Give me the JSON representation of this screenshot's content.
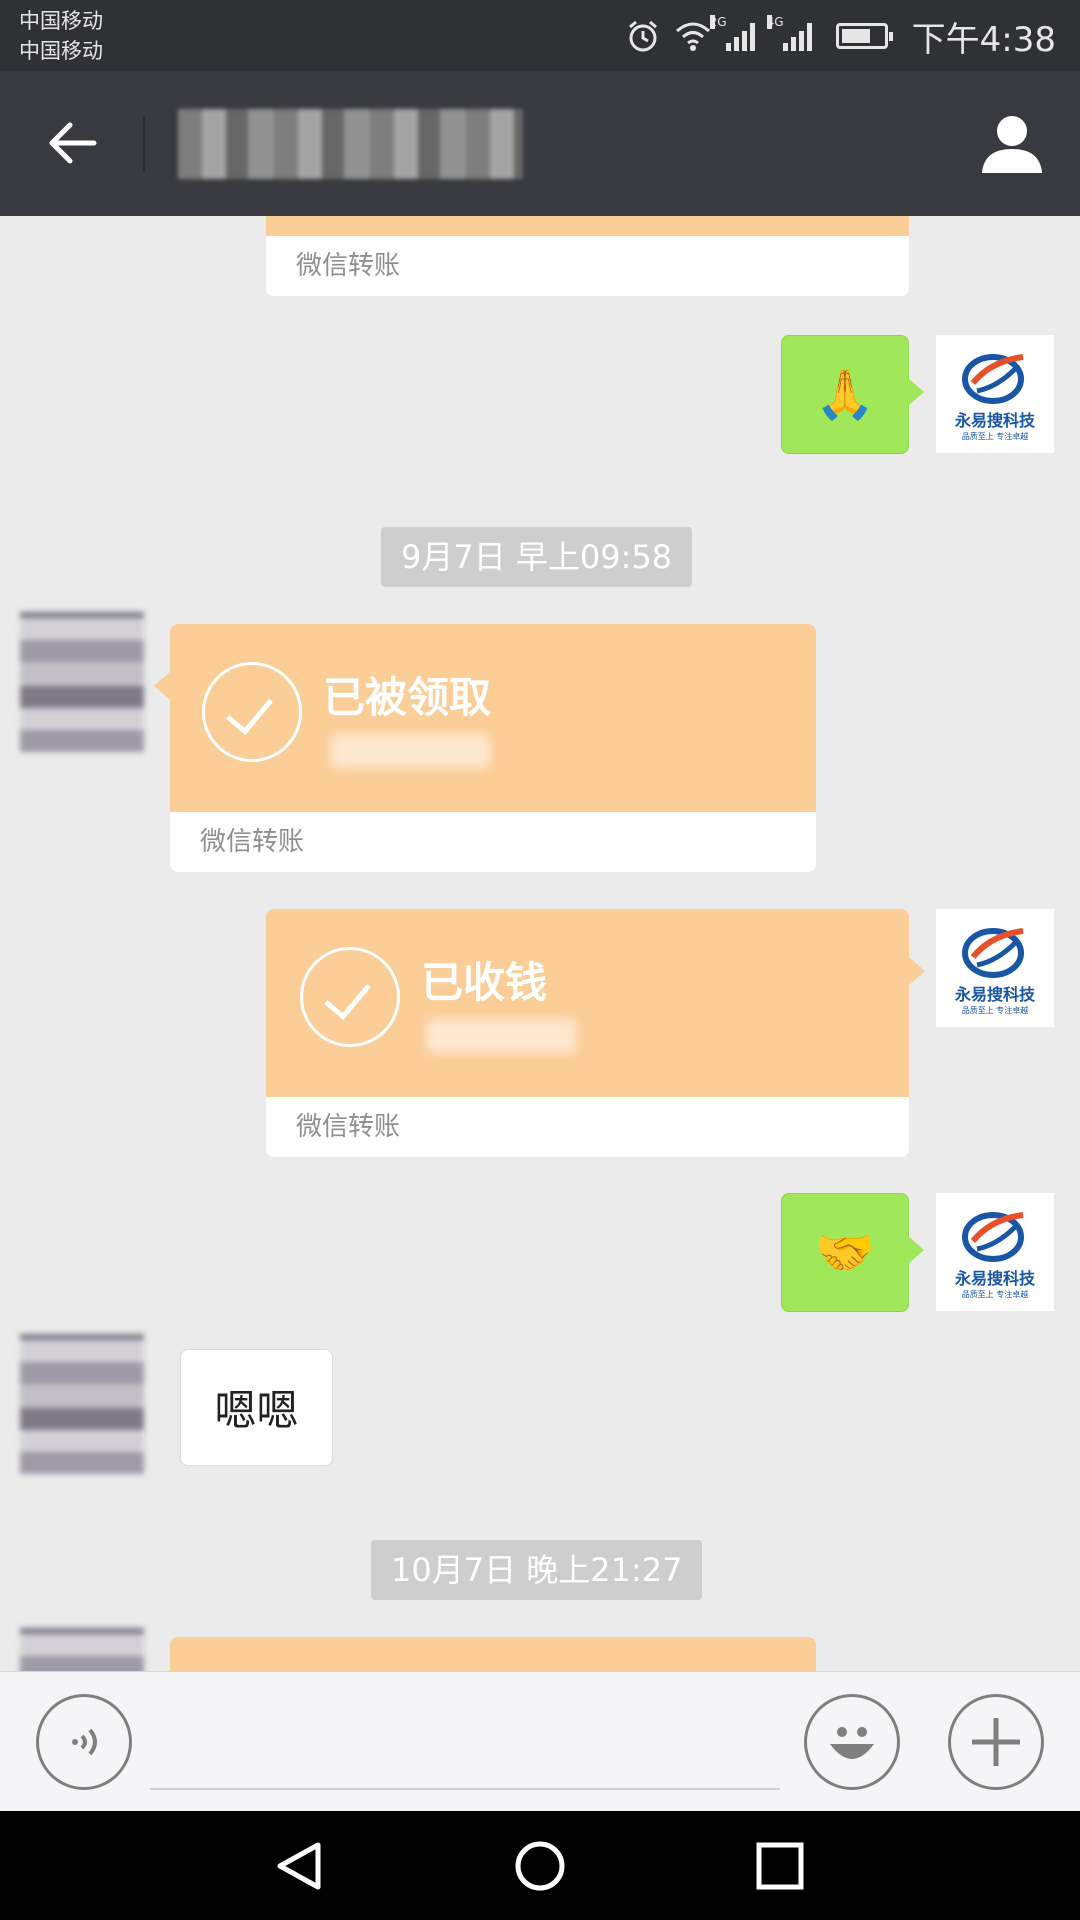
{
  "status_bar": {
    "carrier1": "中国移动",
    "carrier2": "中国移动",
    "net1": "2G",
    "net2": "4G",
    "time": "下午4:38"
  },
  "header": {
    "back_icon": "arrow-left-icon",
    "profile_icon": "person-icon"
  },
  "messages": {
    "transfer_label_1": "微信转账",
    "pray_emoji": "🙏",
    "time1": "9月7日 早上09:58",
    "transfer2_status": "已被领取",
    "transfer_label_2": "微信转账",
    "transfer3_status": "已收钱",
    "transfer_label_3": "微信转账",
    "handshake_emoji": "🤝",
    "reply_text": "嗯嗯",
    "time2": "10月7日 晚上21:27"
  },
  "avatar": {
    "brand": "永易搜科技",
    "slogan": "品质至上 专注卓越"
  },
  "colors": {
    "transfer_orange": "#fbcd97",
    "bubble_green": "#a0e759",
    "header_bg": "#393a3f"
  }
}
